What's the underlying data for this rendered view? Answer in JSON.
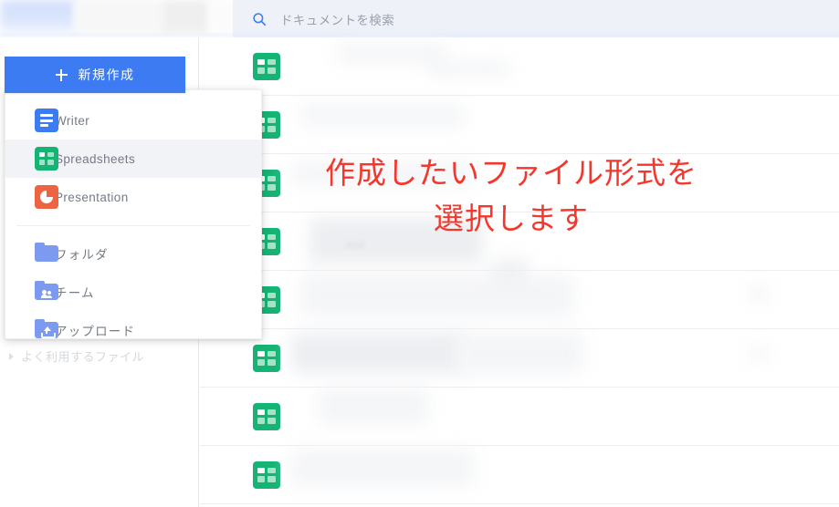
{
  "header": {
    "search": {
      "icon": "search-icon",
      "placeholder": "ドキュメントを検索",
      "value": ""
    }
  },
  "sidebar": {
    "new_button": {
      "icon": "plus-icon",
      "label": "新規作成"
    },
    "sections": [
      {
        "label": "よく利用するファイル",
        "icon": "caret-right-icon",
        "expanded": false
      }
    ]
  },
  "create_menu": {
    "groups": [
      {
        "items": [
          {
            "label": "Writer",
            "icon": "document-icon",
            "color": "#3d7bf2",
            "selected": false
          },
          {
            "label": "Spreadsheets",
            "icon": "spreadsheet-icon",
            "color": "#15b374",
            "selected": true
          },
          {
            "label": "Presentation",
            "icon": "presentation-icon",
            "color": "#ec6442",
            "selected": false
          }
        ]
      },
      {
        "items": [
          {
            "label": "フォルダ",
            "icon": "folder-icon",
            "color": "#7b9af0",
            "selected": false
          },
          {
            "label": "チーム",
            "icon": "team-folder-icon",
            "color": "#7b9af0",
            "selected": false
          },
          {
            "label": "アップロード",
            "icon": "upload-icon",
            "color": "#7b9af0",
            "selected": false
          }
        ]
      }
    ]
  },
  "file_list": {
    "rows": [
      {
        "icon": "spreadsheet-icon",
        "name": "",
        "redacted": true
      },
      {
        "icon": "spreadsheet-icon",
        "name": "",
        "redacted": true
      },
      {
        "icon": "spreadsheet-icon",
        "name": "",
        "redacted": true
      },
      {
        "icon": "spreadsheet-icon",
        "name": "",
        "redacted": true
      },
      {
        "icon": "spreadsheet-icon",
        "name": "",
        "redacted": true
      },
      {
        "icon": "spreadsheet-icon",
        "name": "",
        "redacted": true
      },
      {
        "icon": "spreadsheet-icon",
        "name": "",
        "redacted": true
      },
      {
        "icon": "spreadsheet-icon",
        "name": "",
        "redacted": true
      }
    ]
  },
  "annotation": {
    "color": "#f4372c",
    "line1": "作成したいファイル形式を",
    "line2": "選択します"
  },
  "colors": {
    "primary": "#3d7bf2",
    "search_bg": "#eef1f8",
    "menu_hover": "#f1f3f7",
    "sheet_green": "#15b374",
    "annotation_red": "#f4372c"
  }
}
